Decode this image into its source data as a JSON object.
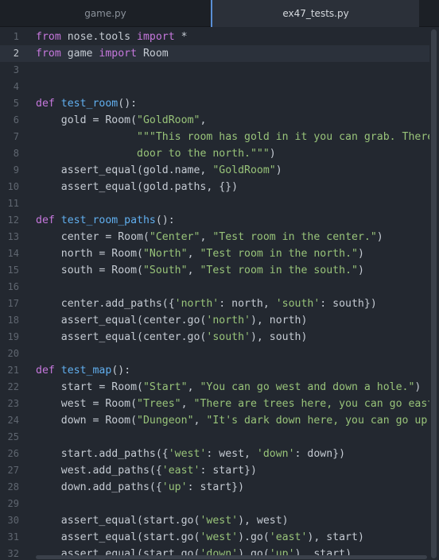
{
  "tabs": [
    {
      "label": "game.py",
      "active": false
    },
    {
      "label": "ex47_tests.py",
      "active": true
    }
  ],
  "editor": {
    "current_line": 2,
    "lines": [
      {
        "number": "1",
        "tokens": [
          {
            "t": "from",
            "c": "kw"
          },
          {
            "t": " nose.tools ",
            "c": "plain"
          },
          {
            "t": "import",
            "c": "kw"
          },
          {
            "t": " *",
            "c": "plain"
          }
        ]
      },
      {
        "number": "2",
        "tokens": [
          {
            "t": "from",
            "c": "kw"
          },
          {
            "t": " game ",
            "c": "plain"
          },
          {
            "t": "import",
            "c": "kw"
          },
          {
            "t": " Room",
            "c": "plain"
          }
        ]
      },
      {
        "number": "3",
        "tokens": []
      },
      {
        "number": "4",
        "tokens": []
      },
      {
        "number": "5",
        "tokens": [
          {
            "t": "def",
            "c": "kw"
          },
          {
            "t": " ",
            "c": "plain"
          },
          {
            "t": "test_room",
            "c": "fn"
          },
          {
            "t": "():",
            "c": "plain"
          }
        ]
      },
      {
        "number": "6",
        "tokens": [
          {
            "t": "    gold = Room(",
            "c": "plain"
          },
          {
            "t": "\"GoldRoom\"",
            "c": "str"
          },
          {
            "t": ",",
            "c": "plain"
          }
        ]
      },
      {
        "number": "7",
        "tokens": [
          {
            "t": "                ",
            "c": "plain"
          },
          {
            "t": "\"\"\"This room has gold in it you can grab. There's a",
            "c": "str"
          }
        ]
      },
      {
        "number": "8",
        "tokens": [
          {
            "t": "                ",
            "c": "plain"
          },
          {
            "t": "door to the north.\"\"\"",
            "c": "str"
          },
          {
            "t": ")",
            "c": "plain"
          }
        ]
      },
      {
        "number": "9",
        "tokens": [
          {
            "t": "    assert_equal(gold.name, ",
            "c": "plain"
          },
          {
            "t": "\"GoldRoom\"",
            "c": "str"
          },
          {
            "t": ")",
            "c": "plain"
          }
        ]
      },
      {
        "number": "10",
        "tokens": [
          {
            "t": "    assert_equal(gold.paths, {})",
            "c": "plain"
          }
        ]
      },
      {
        "number": "11",
        "tokens": []
      },
      {
        "number": "12",
        "tokens": [
          {
            "t": "def",
            "c": "kw"
          },
          {
            "t": " ",
            "c": "plain"
          },
          {
            "t": "test_room_paths",
            "c": "fn"
          },
          {
            "t": "():",
            "c": "plain"
          }
        ]
      },
      {
        "number": "13",
        "tokens": [
          {
            "t": "    center = Room(",
            "c": "plain"
          },
          {
            "t": "\"Center\"",
            "c": "str"
          },
          {
            "t": ", ",
            "c": "plain"
          },
          {
            "t": "\"Test room in the center.\"",
            "c": "str"
          },
          {
            "t": ")",
            "c": "plain"
          }
        ]
      },
      {
        "number": "14",
        "tokens": [
          {
            "t": "    north = Room(",
            "c": "plain"
          },
          {
            "t": "\"North\"",
            "c": "str"
          },
          {
            "t": ", ",
            "c": "plain"
          },
          {
            "t": "\"Test room in the north.\"",
            "c": "str"
          },
          {
            "t": ")",
            "c": "plain"
          }
        ]
      },
      {
        "number": "15",
        "tokens": [
          {
            "t": "    south = Room(",
            "c": "plain"
          },
          {
            "t": "\"South\"",
            "c": "str"
          },
          {
            "t": ", ",
            "c": "plain"
          },
          {
            "t": "\"Test room in the south.\"",
            "c": "str"
          },
          {
            "t": ")",
            "c": "plain"
          }
        ]
      },
      {
        "number": "16",
        "tokens": []
      },
      {
        "number": "17",
        "tokens": [
          {
            "t": "    center.add_paths({",
            "c": "plain"
          },
          {
            "t": "'north'",
            "c": "str"
          },
          {
            "t": ": north, ",
            "c": "plain"
          },
          {
            "t": "'south'",
            "c": "str"
          },
          {
            "t": ": south})",
            "c": "plain"
          }
        ]
      },
      {
        "number": "18",
        "tokens": [
          {
            "t": "    assert_equal(center.go(",
            "c": "plain"
          },
          {
            "t": "'north'",
            "c": "str"
          },
          {
            "t": "), north)",
            "c": "plain"
          }
        ]
      },
      {
        "number": "19",
        "tokens": [
          {
            "t": "    assert_equal(center.go(",
            "c": "plain"
          },
          {
            "t": "'south'",
            "c": "str"
          },
          {
            "t": "), south)",
            "c": "plain"
          }
        ]
      },
      {
        "number": "20",
        "tokens": []
      },
      {
        "number": "21",
        "tokens": [
          {
            "t": "def",
            "c": "kw"
          },
          {
            "t": " ",
            "c": "plain"
          },
          {
            "t": "test_map",
            "c": "fn"
          },
          {
            "t": "():",
            "c": "plain"
          }
        ]
      },
      {
        "number": "22",
        "tokens": [
          {
            "t": "    start = Room(",
            "c": "plain"
          },
          {
            "t": "\"Start\"",
            "c": "str"
          },
          {
            "t": ", ",
            "c": "plain"
          },
          {
            "t": "\"You can go west and down a hole.\"",
            "c": "str"
          },
          {
            "t": ")",
            "c": "plain"
          }
        ]
      },
      {
        "number": "23",
        "tokens": [
          {
            "t": "    west = Room(",
            "c": "plain"
          },
          {
            "t": "\"Trees\"",
            "c": "str"
          },
          {
            "t": ", ",
            "c": "plain"
          },
          {
            "t": "\"There are trees here, you can go east.\"",
            "c": "str"
          },
          {
            "t": ")",
            "c": "plain"
          }
        ]
      },
      {
        "number": "24",
        "tokens": [
          {
            "t": "    down = Room(",
            "c": "plain"
          },
          {
            "t": "\"Dungeon\"",
            "c": "str"
          },
          {
            "t": ", ",
            "c": "plain"
          },
          {
            "t": "\"It's dark down here, you can go up.\"",
            "c": "str"
          },
          {
            "t": ")",
            "c": "plain"
          }
        ]
      },
      {
        "number": "25",
        "tokens": []
      },
      {
        "number": "26",
        "tokens": [
          {
            "t": "    start.add_paths({",
            "c": "plain"
          },
          {
            "t": "'west'",
            "c": "str"
          },
          {
            "t": ": west, ",
            "c": "plain"
          },
          {
            "t": "'down'",
            "c": "str"
          },
          {
            "t": ": down})",
            "c": "plain"
          }
        ]
      },
      {
        "number": "27",
        "tokens": [
          {
            "t": "    west.add_paths({",
            "c": "plain"
          },
          {
            "t": "'east'",
            "c": "str"
          },
          {
            "t": ": start})",
            "c": "plain"
          }
        ]
      },
      {
        "number": "28",
        "tokens": [
          {
            "t": "    down.add_paths({",
            "c": "plain"
          },
          {
            "t": "'up'",
            "c": "str"
          },
          {
            "t": ": start})",
            "c": "plain"
          }
        ]
      },
      {
        "number": "29",
        "tokens": []
      },
      {
        "number": "30",
        "tokens": [
          {
            "t": "    assert_equal(start.go(",
            "c": "plain"
          },
          {
            "t": "'west'",
            "c": "str"
          },
          {
            "t": "), west)",
            "c": "plain"
          }
        ]
      },
      {
        "number": "31",
        "tokens": [
          {
            "t": "    assert_equal(start.go(",
            "c": "plain"
          },
          {
            "t": "'west'",
            "c": "str"
          },
          {
            "t": ").go(",
            "c": "plain"
          },
          {
            "t": "'east'",
            "c": "str"
          },
          {
            "t": "), start)",
            "c": "plain"
          }
        ]
      },
      {
        "number": "32",
        "tokens": [
          {
            "t": "    assert_equal(start.go(",
            "c": "plain"
          },
          {
            "t": "'down'",
            "c": "str"
          },
          {
            "t": ").go(",
            "c": "plain"
          },
          {
            "t": "'up'",
            "c": "str"
          },
          {
            "t": "), start)",
            "c": "plain"
          }
        ]
      }
    ]
  },
  "colors": {
    "keyword": "#c678dd",
    "function": "#61afef",
    "string": "#98c379",
    "text": "#c5cbd3",
    "background": "#232830",
    "active_tab_border": "#5a8fd6"
  }
}
